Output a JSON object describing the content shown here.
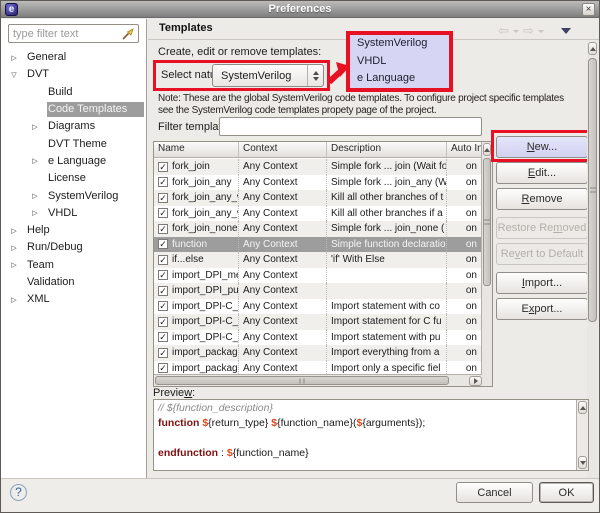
{
  "window": {
    "title": "Preferences",
    "close_glyph": "×",
    "app_icon_glyph": "e"
  },
  "sidebar": {
    "filter_placeholder": "type filter text",
    "items": [
      {
        "label": "General",
        "level": 0,
        "state": "collapsed",
        "selected": false
      },
      {
        "label": "DVT",
        "level": 0,
        "state": "expanded",
        "selected": false
      },
      {
        "label": "Build",
        "level": 1,
        "state": "leaf",
        "selected": false
      },
      {
        "label": "Code Templates",
        "level": 1,
        "state": "leaf",
        "selected": true
      },
      {
        "label": "Diagrams",
        "level": 1,
        "state": "collapsed",
        "selected": false
      },
      {
        "label": "DVT Theme",
        "level": 1,
        "state": "leaf",
        "selected": false
      },
      {
        "label": "e Language",
        "level": 1,
        "state": "collapsed",
        "selected": false
      },
      {
        "label": "License",
        "level": 1,
        "state": "leaf",
        "selected": false
      },
      {
        "label": "SystemVerilog",
        "level": 1,
        "state": "collapsed",
        "selected": false
      },
      {
        "label": "VHDL",
        "level": 1,
        "state": "collapsed",
        "selected": false
      },
      {
        "label": "Help",
        "level": 0,
        "state": "collapsed",
        "selected": false
      },
      {
        "label": "Run/Debug",
        "level": 0,
        "state": "collapsed",
        "selected": false
      },
      {
        "label": "Team",
        "level": 0,
        "state": "collapsed",
        "selected": false
      },
      {
        "label": "Validation",
        "level": 0,
        "state": "leaf",
        "selected": false
      },
      {
        "label": "XML",
        "level": 0,
        "state": "collapsed",
        "selected": false
      }
    ]
  },
  "header": {
    "title": "Templates"
  },
  "nature": {
    "create_label": "Create, edit or remove templates:",
    "select_label": "Select nature:",
    "value": "SystemVerilog",
    "popup_options": [
      "SystemVerilog",
      "VHDL",
      "e Language"
    ]
  },
  "note": {
    "line1": "Note:  These are the global SystemVerilog code templates. To configure project specific templates",
    "line2": "see the SystemVerilog code templates propety page of the project."
  },
  "filter": {
    "label": "Filter templates:",
    "value": ""
  },
  "table": {
    "columns": [
      "Name",
      "Context",
      "Description",
      "Auto In"
    ],
    "rows": [
      {
        "checked": true,
        "name": "fork_join",
        "context": "Any Context",
        "description": "Simple fork ... join (Wait fo",
        "auto": "on",
        "selected": false
      },
      {
        "checked": true,
        "name": "fork_join_any",
        "context": "Any Context",
        "description": "Simple fork ... join_any (W",
        "auto": "on",
        "selected": false
      },
      {
        "checked": true,
        "name": "fork_join_any_with",
        "context": "Any Context",
        "description": "Kill all other branches of t",
        "auto": "on",
        "selected": false
      },
      {
        "checked": true,
        "name": "fork_join_any_with",
        "context": "Any Context",
        "description": "Kill all other branches if a",
        "auto": "on",
        "selected": false
      },
      {
        "checked": true,
        "name": "fork_join_none",
        "context": "Any Context",
        "description": "Simple fork ... join_none (",
        "auto": "on",
        "selected": false
      },
      {
        "checked": true,
        "name": "function",
        "context": "Any Context",
        "description": "Simple function declaratio",
        "auto": "on",
        "selected": true
      },
      {
        "checked": true,
        "name": "if...else",
        "context": "Any Context",
        "description": "'if' With Else",
        "auto": "on",
        "selected": false
      },
      {
        "checked": true,
        "name": "import_DPI_metho",
        "context": "Any Context",
        "description": "",
        "auto": "on",
        "selected": false
      },
      {
        "checked": true,
        "name": "import_DPI_pure_",
        "context": "Any Context",
        "description": "",
        "auto": "on",
        "selected": false
      },
      {
        "checked": true,
        "name": "import_DPI-C_cont",
        "context": "Any Context",
        "description": "Import statement with co",
        "auto": "on",
        "selected": false
      },
      {
        "checked": true,
        "name": "import_DPI-C_met",
        "context": "Any Context",
        "description": "Import statement for C fu",
        "auto": "on",
        "selected": false
      },
      {
        "checked": true,
        "name": "import_DPI-C_pure",
        "context": "Any Context",
        "description": "Import statement with pu",
        "auto": "on",
        "selected": false
      },
      {
        "checked": true,
        "name": "import_package_a",
        "context": "Any Context",
        "description": "Import everything from a",
        "auto": "on",
        "selected": false
      },
      {
        "checked": true,
        "name": "import_package_s",
        "context": "Any Context",
        "description": "Import only a specific fiel",
        "auto": "on",
        "selected": false
      }
    ]
  },
  "side_buttons": [
    {
      "label": "New...",
      "mnemonic": "N",
      "enabled": true,
      "annotated": true
    },
    {
      "label": "Edit...",
      "mnemonic": "E",
      "enabled": true
    },
    {
      "label": "Remove",
      "mnemonic": "R",
      "enabled": true
    },
    {
      "label": "Restore Removed",
      "mnemonic": "m",
      "enabled": false
    },
    {
      "label": "Revert to Default",
      "mnemonic": "v",
      "enabled": false
    },
    {
      "label": "Import...",
      "mnemonic": "I",
      "enabled": true
    },
    {
      "label": "Export...",
      "mnemonic": "x",
      "enabled": true
    }
  ],
  "preview": {
    "label": "Preview:",
    "mnemonic": "w",
    "code": [
      [
        {
          "t": "// ${function_description}",
          "s": "comment"
        }
      ],
      [
        {
          "t": "function",
          "s": "keyword"
        },
        {
          "t": " ",
          "s": "plain"
        },
        {
          "t": "$",
          "s": "dollar"
        },
        {
          "t": "{return_type} ",
          "s": "plain"
        },
        {
          "t": "$",
          "s": "dollar"
        },
        {
          "t": "{function_name}(",
          "s": "plain"
        },
        {
          "t": "$",
          "s": "dollar"
        },
        {
          "t": "{arguments});",
          "s": "plain"
        }
      ],
      [],
      [
        {
          "t": "endfunction",
          "s": "keyword"
        },
        {
          "t": " : ",
          "s": "plain"
        },
        {
          "t": "$",
          "s": "dollar"
        },
        {
          "t": "{function_name}",
          "s": "plain"
        }
      ]
    ]
  },
  "footer": {
    "help": "?",
    "cancel": "Cancel",
    "ok": "OK"
  },
  "colors": {
    "annotation": "#e81123",
    "popup_bg": "#d6d6f4",
    "selection": "#9d9d9d",
    "keyword": "#7f1111",
    "dollar": "#e0491b",
    "comment": "#8a8a8a"
  }
}
